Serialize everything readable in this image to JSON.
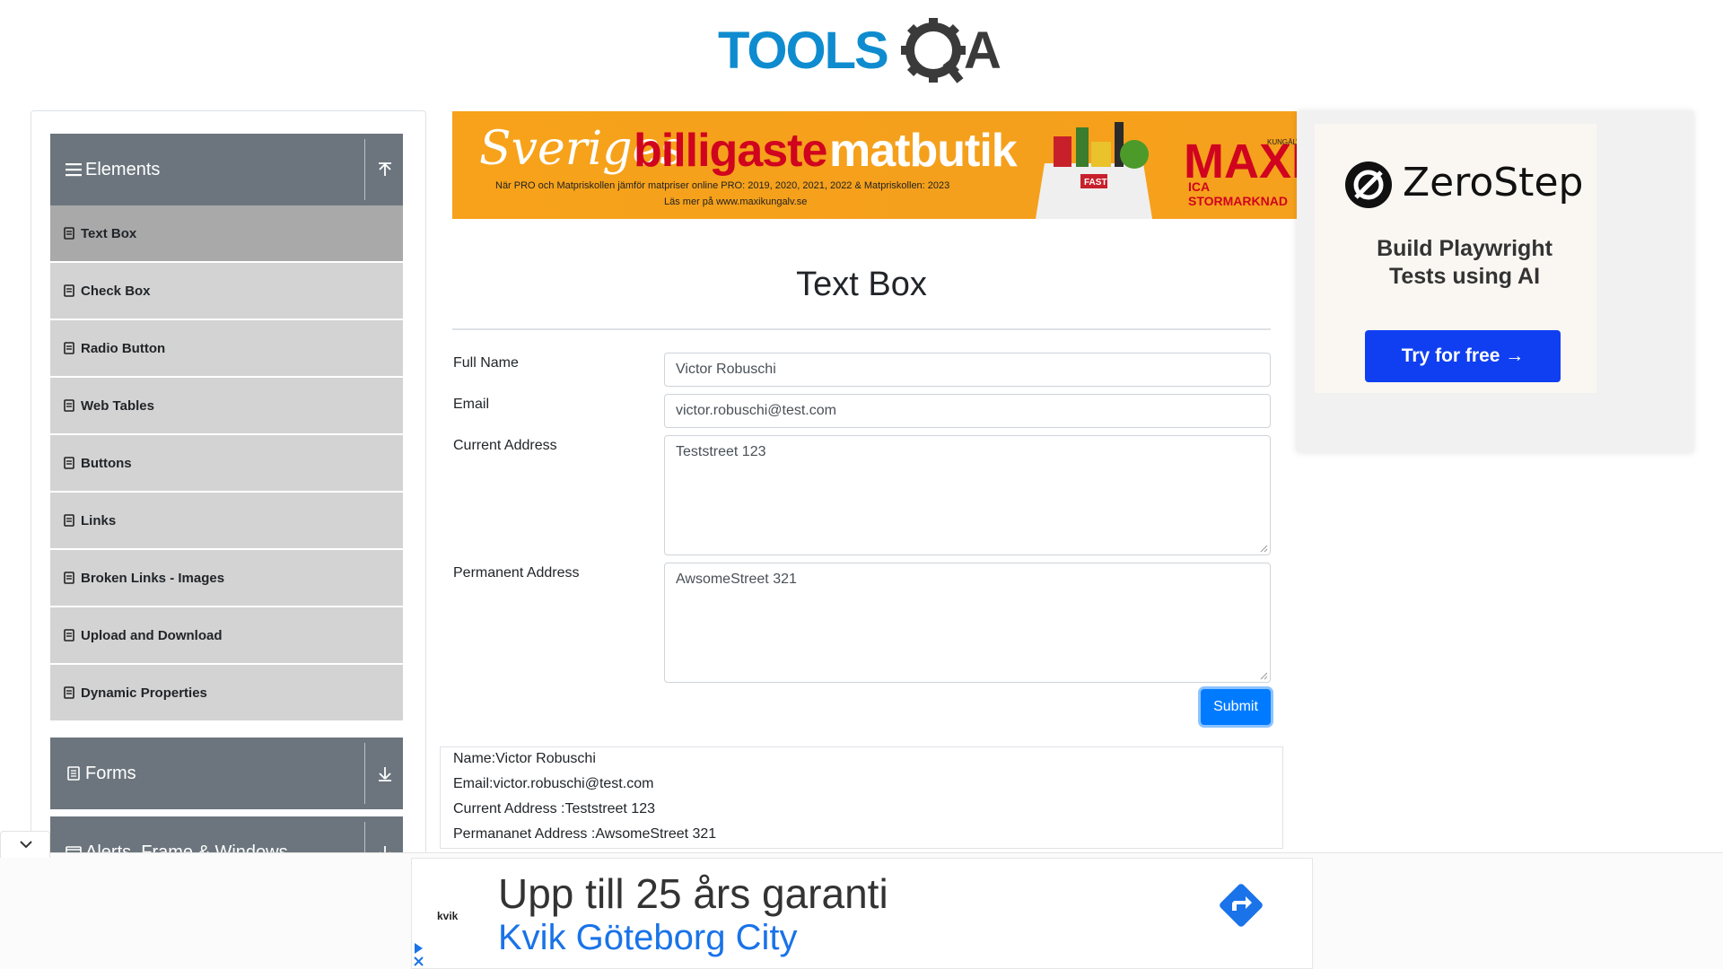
{
  "header": {
    "logo_text": "TOOLSQA"
  },
  "sidebar": {
    "groups": [
      {
        "label": "Elements"
      },
      {
        "label": "Forms"
      },
      {
        "label": "Alerts, Frame & Windows"
      }
    ],
    "items": [
      {
        "label": "Text Box"
      },
      {
        "label": "Check Box"
      },
      {
        "label": "Radio Button"
      },
      {
        "label": "Web Tables"
      },
      {
        "label": "Buttons"
      },
      {
        "label": "Links"
      },
      {
        "label": "Broken Links - Images"
      },
      {
        "label": "Upload and Download"
      },
      {
        "label": "Dynamic Properties"
      }
    ]
  },
  "ad_top": {
    "line1": "Sveriges",
    "line2": "billigaste",
    "line3": "matbutik",
    "fine1": "När PRO och Matpriskollen jämför matpriser online PRO: 2019, 2020, 2021, 2022 & Matpriskollen: 2023",
    "fine2": "Läs mer på www.maxikungalv.se",
    "brand": "MAXI",
    "brand_sub": "ICA STORMARKNAD",
    "brand_tiny": "KUNGÄLV",
    "bag_label": "FAST"
  },
  "ad_right": {
    "brand": "ZeroStep",
    "tagline1": "Build Playwright",
    "tagline2": "Tests using AI",
    "button": "Try for free →"
  },
  "form": {
    "title": "Text Box",
    "full_name_label": "Full Name",
    "full_name_value": "Victor Robuschi",
    "email_label": "Email",
    "email_value": "victor.robuschi@test.com",
    "current_address_label": "Current Address",
    "current_address_value": "Teststreet 123",
    "permanent_address_label": "Permanent Address",
    "permanent_address_value": "AwsomeStreet 321",
    "submit": "Submit"
  },
  "output": {
    "name": "Name:Victor Robuschi",
    "email": "Email:victor.robuschi@test.com",
    "current": "Current Address :Teststreet 123",
    "permanent": "Permananet Address :AwsomeStreet 321"
  },
  "ad_bottom": {
    "brand": "kvik",
    "headline": "Upp till 25 års garanti",
    "sub": "Kvik Göteborg City"
  },
  "colors": {
    "sidebar_header": "#6c757d",
    "sidebar_item": "#d3d3d3",
    "sidebar_active": "#a9a9a9",
    "submit": "#007bff",
    "ad_link": "#1a73e8"
  }
}
